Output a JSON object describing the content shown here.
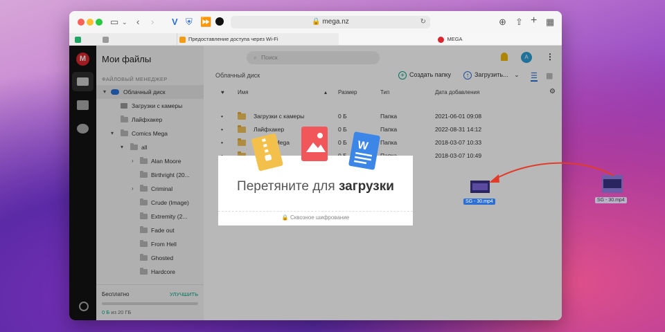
{
  "browser": {
    "url": "mega.nz",
    "tabs": [
      {
        "label": "Предоставление доступа через Wi-Fi"
      },
      {
        "label": "MEGA"
      }
    ]
  },
  "rail": {
    "logo": "M"
  },
  "sidebar": {
    "title": "Мои файлы",
    "section": "ФАЙЛОВЫЙ МЕНЕДЖЕР",
    "items": [
      {
        "label": "Облачный диск"
      },
      {
        "label": "Загрузки с камеры"
      },
      {
        "label": "Лайфхакер"
      },
      {
        "label": "Comics Mega"
      },
      {
        "label": "all"
      },
      {
        "label": "Alan Moore"
      },
      {
        "label": "Birthright (20..."
      },
      {
        "label": "Criminal"
      },
      {
        "label": "Crude (Image)"
      },
      {
        "label": "Extremity (2..."
      },
      {
        "label": "Fade out"
      },
      {
        "label": "From Hell"
      },
      {
        "label": "Ghosted"
      },
      {
        "label": "Hardcore"
      }
    ],
    "plan": "Бесплатно",
    "upgrade": "УЛУЧШИТЬ",
    "quota_used": "0 Б",
    "quota_rest": " из 20 ГБ"
  },
  "main": {
    "search_placeholder": "Поиск",
    "breadcrumb": "Облачный диск",
    "create_folder": "Создать папку",
    "upload": "Загрузить...",
    "avatar": "A",
    "headers": {
      "name": "Имя",
      "size": "Размер",
      "type": "Тип",
      "date": "Дата добавления"
    },
    "rows": [
      {
        "name": "Загрузки с камеры",
        "size": "0 Б",
        "type": "Папка",
        "date": "2021-06-01 09:08"
      },
      {
        "name": "Лайфхакер",
        "size": "0 Б",
        "type": "Папка",
        "date": "2022-08-31 14:12"
      },
      {
        "name": "Comics Mega",
        "size": "0 Б",
        "type": "Папка",
        "date": "2018-03-07 10:33"
      },
      {
        "name": "",
        "size": "0 Б",
        "type": "Папка",
        "date": "2018-03-07 10:49"
      }
    ]
  },
  "dropzone": {
    "title_light": "Перетяните для ",
    "title_bold": "загрузки",
    "footer": "Сквозное шифрование"
  },
  "drag_file": {
    "name": "SG - 30.mp4"
  },
  "desktop_file": {
    "name": "SG - 30.mp4"
  },
  "colors": {
    "accent": "#00a382",
    "mega_red": "#d9272e",
    "selection": "#2b6fd6"
  }
}
